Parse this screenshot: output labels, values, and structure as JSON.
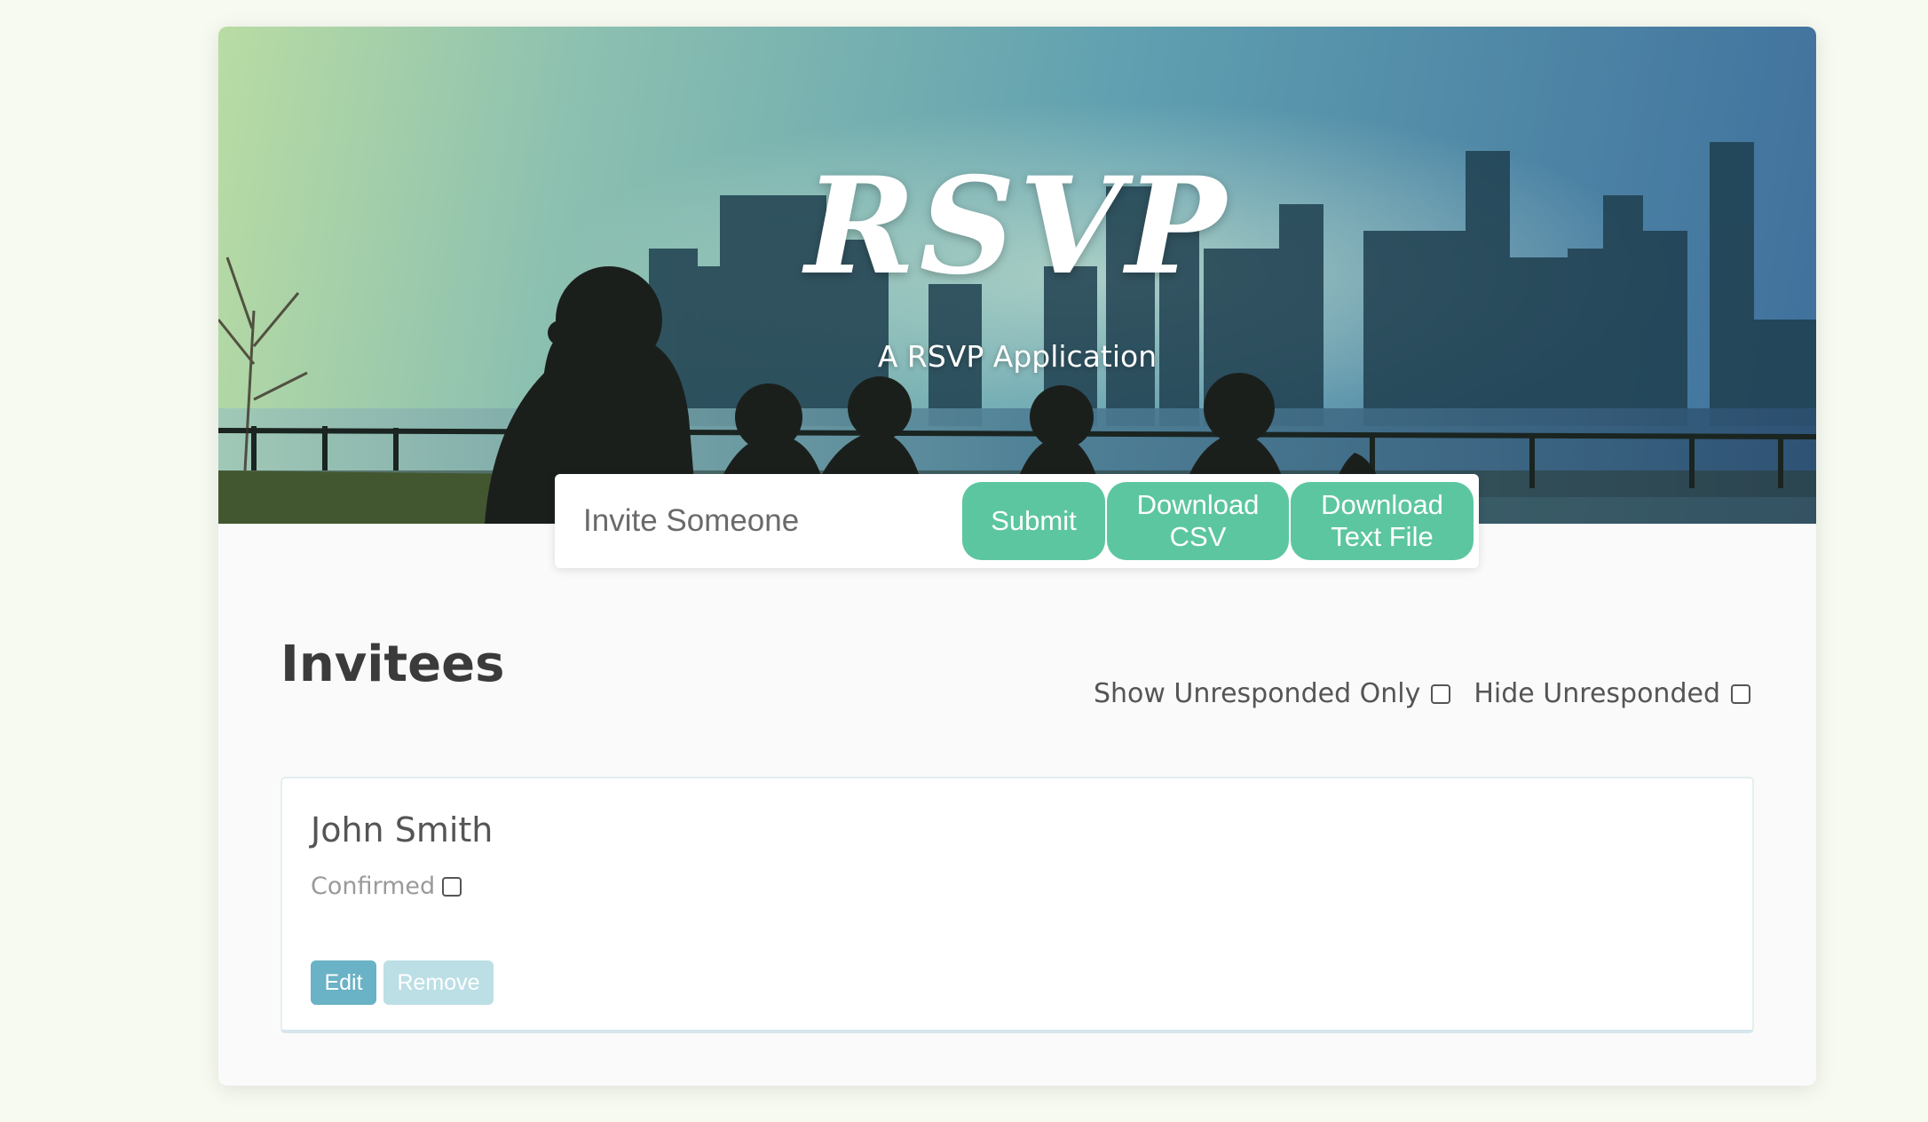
{
  "hero": {
    "title": "RSVP",
    "subtitle": "A RSVP Application"
  },
  "invite_form": {
    "placeholder": "Invite Someone",
    "value": "",
    "submit_label": "Submit",
    "download_csv_label": "Download\nCSV",
    "download_text_label": "Download\nText File"
  },
  "invitees": {
    "heading": "Invitees",
    "filters": {
      "show_unresponded_label": "Show Unresponded Only",
      "show_unresponded_checked": false,
      "hide_unresponded_label": "Hide Unresponded",
      "hide_unresponded_checked": false
    },
    "list": [
      {
        "name": "John Smith",
        "status_label": "Confirmed",
        "confirmed": false,
        "edit_label": "Edit",
        "remove_label": "Remove"
      }
    ]
  },
  "colors": {
    "accent_green": "#5cc6a0",
    "edit_blue": "#6ab2c6",
    "remove_light_blue": "#bcdfe5",
    "page_background": "#f7faf1"
  }
}
